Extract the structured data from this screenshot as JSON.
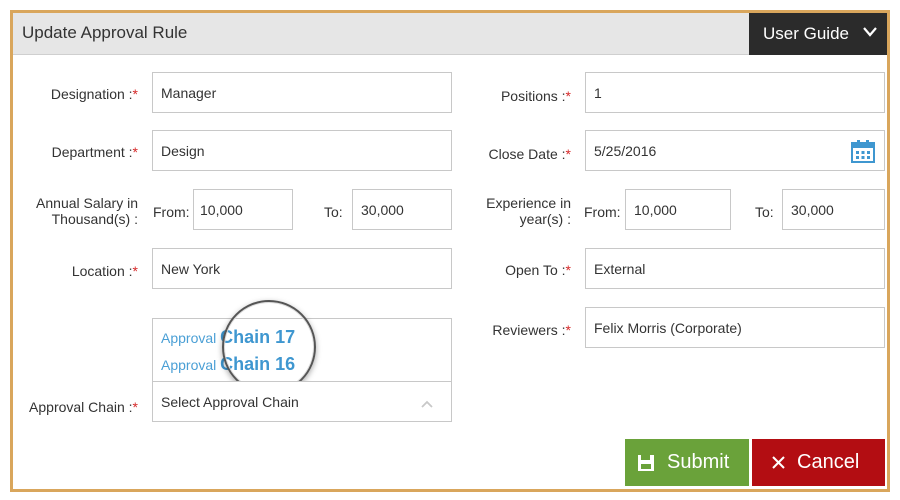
{
  "header": {
    "title": "Update Approval Rule",
    "user_guide_label": "User Guide"
  },
  "form": {
    "designation": {
      "label": "Designation :",
      "value": "Manager"
    },
    "department": {
      "label": "Department :",
      "value": "Design"
    },
    "annual_salary": {
      "label_line1": "Annual Salary in",
      "label_line2": "Thousand(s) :",
      "from_label": "From:",
      "from_value": "10,000",
      "to_label": "To:",
      "to_value": "30,000"
    },
    "location": {
      "label": "Location :",
      "value": "New York"
    },
    "approval_chain": {
      "label": "Approval Chain :",
      "placeholder": "Select Approval Chain",
      "options": [
        {
          "prefix": "Approval",
          "suffix": "Chain 17"
        },
        {
          "prefix": "Approval",
          "suffix": "Chain 16"
        }
      ]
    },
    "positions": {
      "label": "Positions :",
      "value": "1"
    },
    "close_date": {
      "label": "Close Date :",
      "value": "5/25/2016"
    },
    "experience": {
      "label_line1": "Experience in",
      "label_line2": "year(s) :",
      "from_label": "From:",
      "from_value": "10,000",
      "to_label": "To:",
      "to_value": "30,000"
    },
    "open_to": {
      "label": "Open To :",
      "value": "External"
    },
    "reviewers": {
      "label": "Reviewers :",
      "value": "Felix Morris (Corporate)"
    },
    "required_mark": "*"
  },
  "actions": {
    "submit_label": "Submit",
    "cancel_label": "Cancel"
  },
  "colors": {
    "frame_border": "#d9a65c",
    "header_bg": "#e6e6e6",
    "guide_bg": "#2b2b2b",
    "required": "#d62828",
    "link_blue": "#3f97d0",
    "submit_bg": "#6aa23a",
    "cancel_bg": "#b30d12"
  },
  "icons": {
    "user_guide": "chevron-down-icon",
    "close_date": "calendar-icon",
    "select": "chevron-up-icon",
    "submit": "floppy-disk-icon",
    "cancel": "close-icon"
  }
}
